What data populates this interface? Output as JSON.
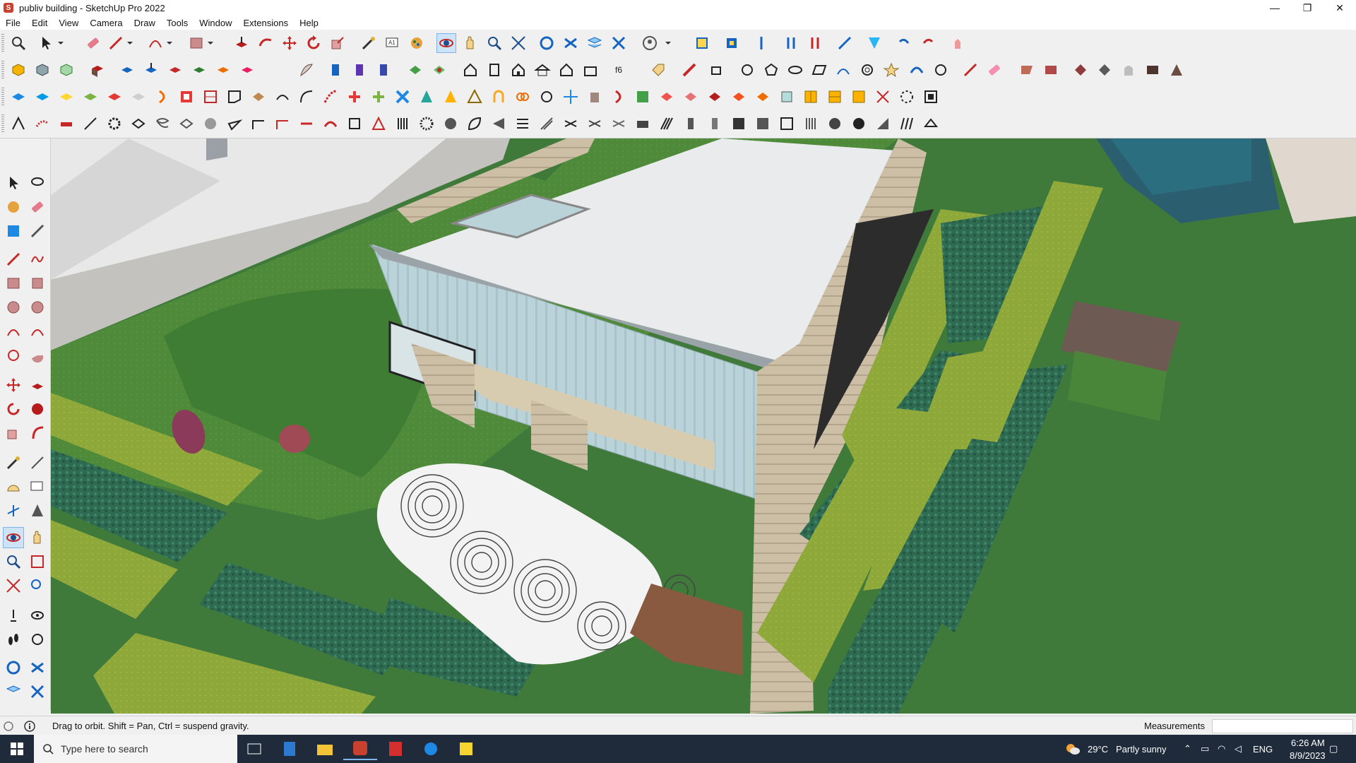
{
  "window": {
    "title": "publiv building - SketchUp Pro 2022",
    "minimize": "—",
    "restore": "❐",
    "close": "✕"
  },
  "menu": [
    "File",
    "Edit",
    "View",
    "Camera",
    "Draw",
    "Tools",
    "Window",
    "Extensions",
    "Help"
  ],
  "status": {
    "hint": "Drag to orbit. Shift = Pan, Ctrl = suspend gravity.",
    "measurements_label": "Measurements",
    "measurements_value": ""
  },
  "taskbar": {
    "search_placeholder": "Type here to search",
    "weather_temp": "29°C",
    "weather_text": "Partly sunny",
    "language": "ENG",
    "time": "6:26 AM",
    "date": "8/9/2023"
  },
  "colors": {
    "titlebar": "#ffffff",
    "toolbar_bg": "#f0f0f0",
    "active_tool": "#cde3f7",
    "taskbar": "#1f2a3a",
    "lawn": "#4e8a3a",
    "hedge": "#2f6b52",
    "roof": "#e9ebec",
    "glass": "#b9d3d8",
    "stone": "#cdbfa6"
  },
  "active_tool": "orbit-icon"
}
